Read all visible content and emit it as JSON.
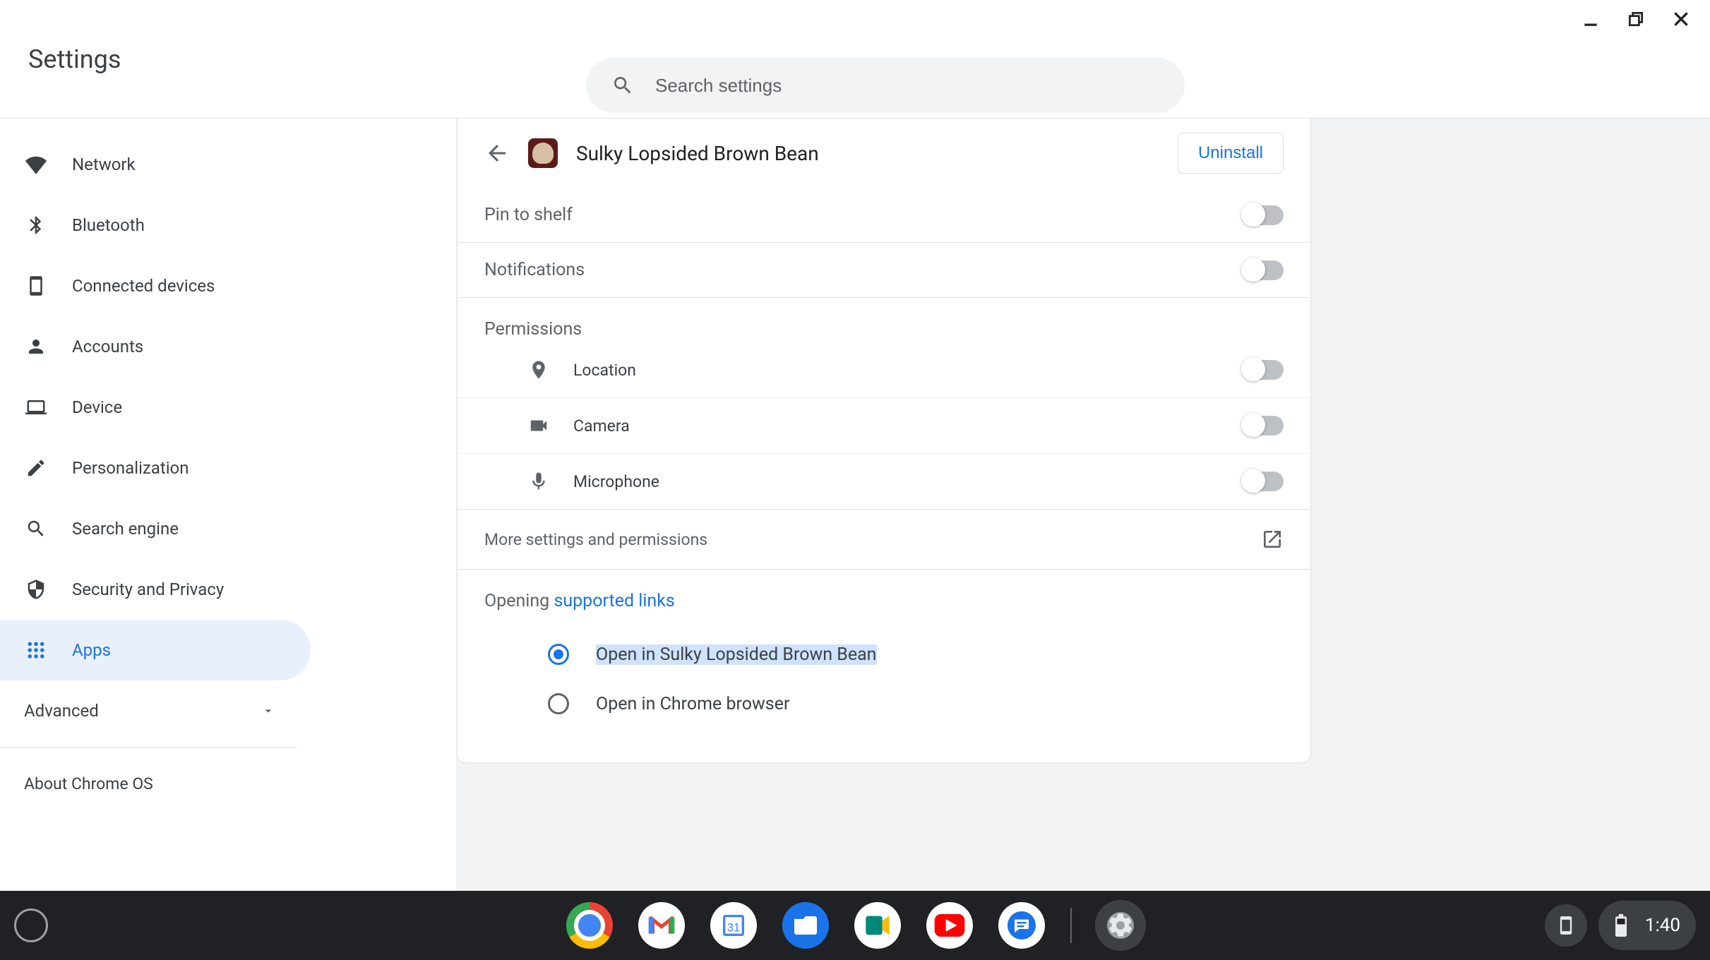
{
  "window": {
    "title": "Settings"
  },
  "search": {
    "placeholder": "Search settings"
  },
  "sidebar": {
    "items": [
      {
        "label": "Network"
      },
      {
        "label": "Bluetooth"
      },
      {
        "label": "Connected devices"
      },
      {
        "label": "Accounts"
      },
      {
        "label": "Device"
      },
      {
        "label": "Personalization"
      },
      {
        "label": "Search engine"
      },
      {
        "label": "Security and Privacy"
      },
      {
        "label": "Apps"
      }
    ],
    "advanced": "Advanced",
    "about": "About Chrome OS"
  },
  "app": {
    "name": "Sulky Lopsided Brown Bean",
    "uninstall": "Uninstall",
    "pin_label": "Pin to shelf",
    "notifications_label": "Notifications",
    "permissions_label": "Permissions",
    "permissions": [
      {
        "label": "Location"
      },
      {
        "label": "Camera"
      },
      {
        "label": "Microphone"
      }
    ],
    "more_label": "More settings and permissions",
    "links": {
      "prefix": "Opening ",
      "link_text": "supported links",
      "option1": "Open in Sulky Lopsided Brown Bean",
      "option2": "Open in Chrome browser"
    }
  },
  "status": {
    "time": "1:40"
  }
}
